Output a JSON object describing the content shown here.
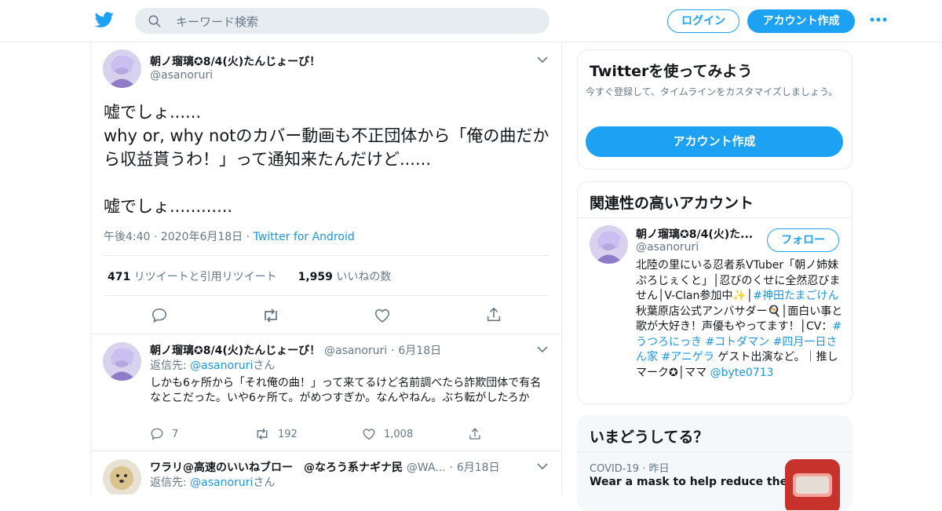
{
  "header": {
    "search_placeholder": "キーワード検索",
    "login_label": "ログイン",
    "signup_label": "アカウント作成"
  },
  "main_tweet": {
    "display_name": "朝ノ瑠璃✪8/4(火)たんじょーび！",
    "handle": "@asanoruri",
    "text": "嘘でしょ......\nwhy or, why notのカバー動画も不正団体から「俺の曲だから収益貰うわ！」って通知来たんだけど......\n\n嘘でしょ............",
    "time": "午後4:40",
    "date": "2020年6月18日",
    "source": "Twitter for Android",
    "retweets_count": "471",
    "retweets_label": "リツイートと引用リツイート",
    "likes_count": "1,959",
    "likes_label": "いいねの数"
  },
  "replies": [
    {
      "display_name": "朝ノ瑠璃✪8/4(火)たんじょーび！",
      "handle": "@asanoruri",
      "date": "6月18日",
      "reply_to_prefix": "返信先: ",
      "reply_to_handle": "@asanoruri",
      "reply_to_suffix": "さん",
      "text": "しかも6ヶ所から「それ俺の曲！」って来てるけど名前調べたら詐欺団体で有名なとこだった。いや6ヶ所て。がめつすぎか。なんやねん。ぶち転がしたろか",
      "replies_count": "7",
      "retweets_count": "192",
      "likes_count": "1,008"
    },
    {
      "display_name": "ワラリ@高速のいいねブロー　@なろう系ナギナ民",
      "handle": "@WA...",
      "date": "6月18日",
      "reply_to_prefix": "返信先: ",
      "reply_to_handle": "@asanoruri",
      "reply_to_suffix": "さん"
    }
  ],
  "signup_card": {
    "title": "Twitterを使ってみよう",
    "subtitle": "今すぐ登録して、タイムラインをカスタマイズしましょう。",
    "button_label": "アカウント作成"
  },
  "related_card": {
    "title": "関連性の高いアカウント",
    "display_name": "朝ノ瑠璃✪8/4(火)た...",
    "handle": "@asanoruri",
    "follow_label": "フォロー",
    "bio_1": "北陸の里にいる忍者系VTuber「朝ノ姉妹ぷろじぇくと」│忍びのくせに全然忍びません│V-Clan参加中✨│",
    "bio_tag_1": "#神田たまごけん",
    "bio_2": " 秋葉原店公式アンバサダー🍳│面白い事と歌が大好き！声優もやってます！│CV：",
    "bio_tag_2": "#うつろにっき",
    "bio_tag_3": "#コトダマン",
    "bio_tag_4": "#四月一日さん家",
    "bio_tag_5": "#アニゲラ",
    "bio_3": " ゲスト出演など。｜推しマーク✪│ママ ",
    "bio_mention": "@byte0713"
  },
  "trends_card": {
    "title": "いまどうしてる？",
    "category": "COVID-19",
    "time": "昨日",
    "headline": "Wear a mask to help reduce the"
  },
  "colors": {
    "brand": "#1da1f2",
    "link": "#1b95e0",
    "muted": "#657786",
    "border": "#e6ecf0"
  }
}
